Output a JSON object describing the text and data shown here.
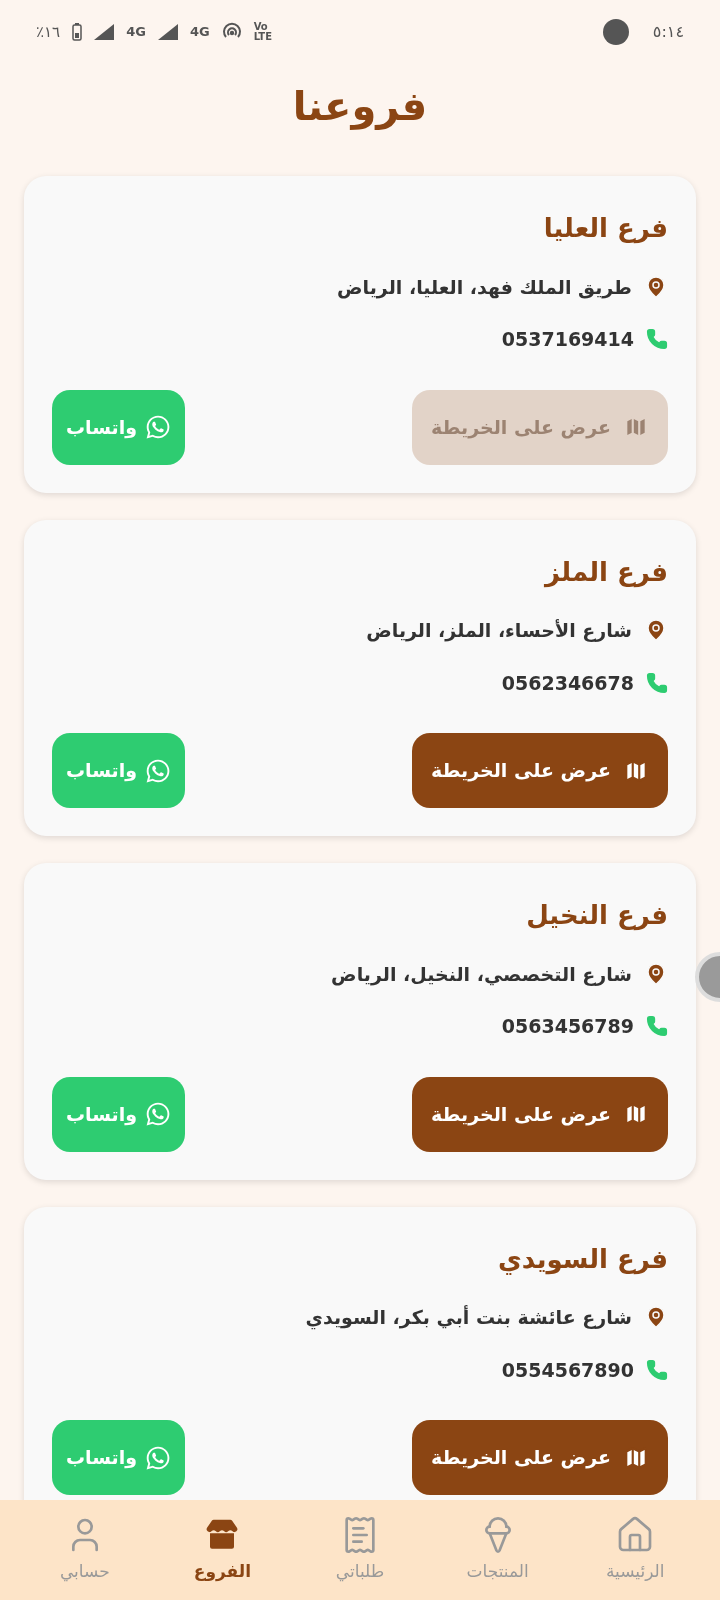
{
  "status_bar": {
    "time": "٥:١٤",
    "battery": "٪١٦",
    "network_1": "4G",
    "network_2": "4G",
    "volte": "Vo LTE"
  },
  "header": {
    "title": "فروعنا"
  },
  "branches": [
    {
      "name": "فرع العليا",
      "address": "طريق الملك فهد، العليا، الرياض",
      "phone": "0537169414",
      "map_button": {
        "label": "عرض على الخريطة",
        "disabled": true
      },
      "whatsapp_button": {
        "label": "واتساب"
      }
    },
    {
      "name": "فرع الملز",
      "address": "شارع الأحساء، الملز، الرياض",
      "phone": "0562346678",
      "map_button": {
        "label": "عرض على الخريطة",
        "disabled": false
      },
      "whatsapp_button": {
        "label": "واتساب"
      }
    },
    {
      "name": "فرع النخيل",
      "address": "شارع التخصصي، النخيل، الرياض",
      "phone": "0563456789",
      "map_button": {
        "label": "عرض على الخريطة",
        "disabled": false
      },
      "whatsapp_button": {
        "label": "واتساب"
      }
    },
    {
      "name": "فرع السويدي",
      "address": "شارع عائشة بنت أبي بكر، السويدي",
      "phone": "0554567890",
      "map_button": {
        "label": "عرض على الخريطة",
        "disabled": false
      },
      "whatsapp_button": {
        "label": "واتساب"
      }
    }
  ],
  "bottom_nav": [
    {
      "kind": "home",
      "label": "الرئيسية",
      "selected": false
    },
    {
      "kind": "products",
      "label": "المنتجات",
      "selected": false
    },
    {
      "kind": "orders",
      "label": "طلباتي",
      "selected": false
    },
    {
      "kind": "branches",
      "label": "الفروع",
      "selected": true
    },
    {
      "kind": "account",
      "label": "حسابي",
      "selected": false
    }
  ]
}
